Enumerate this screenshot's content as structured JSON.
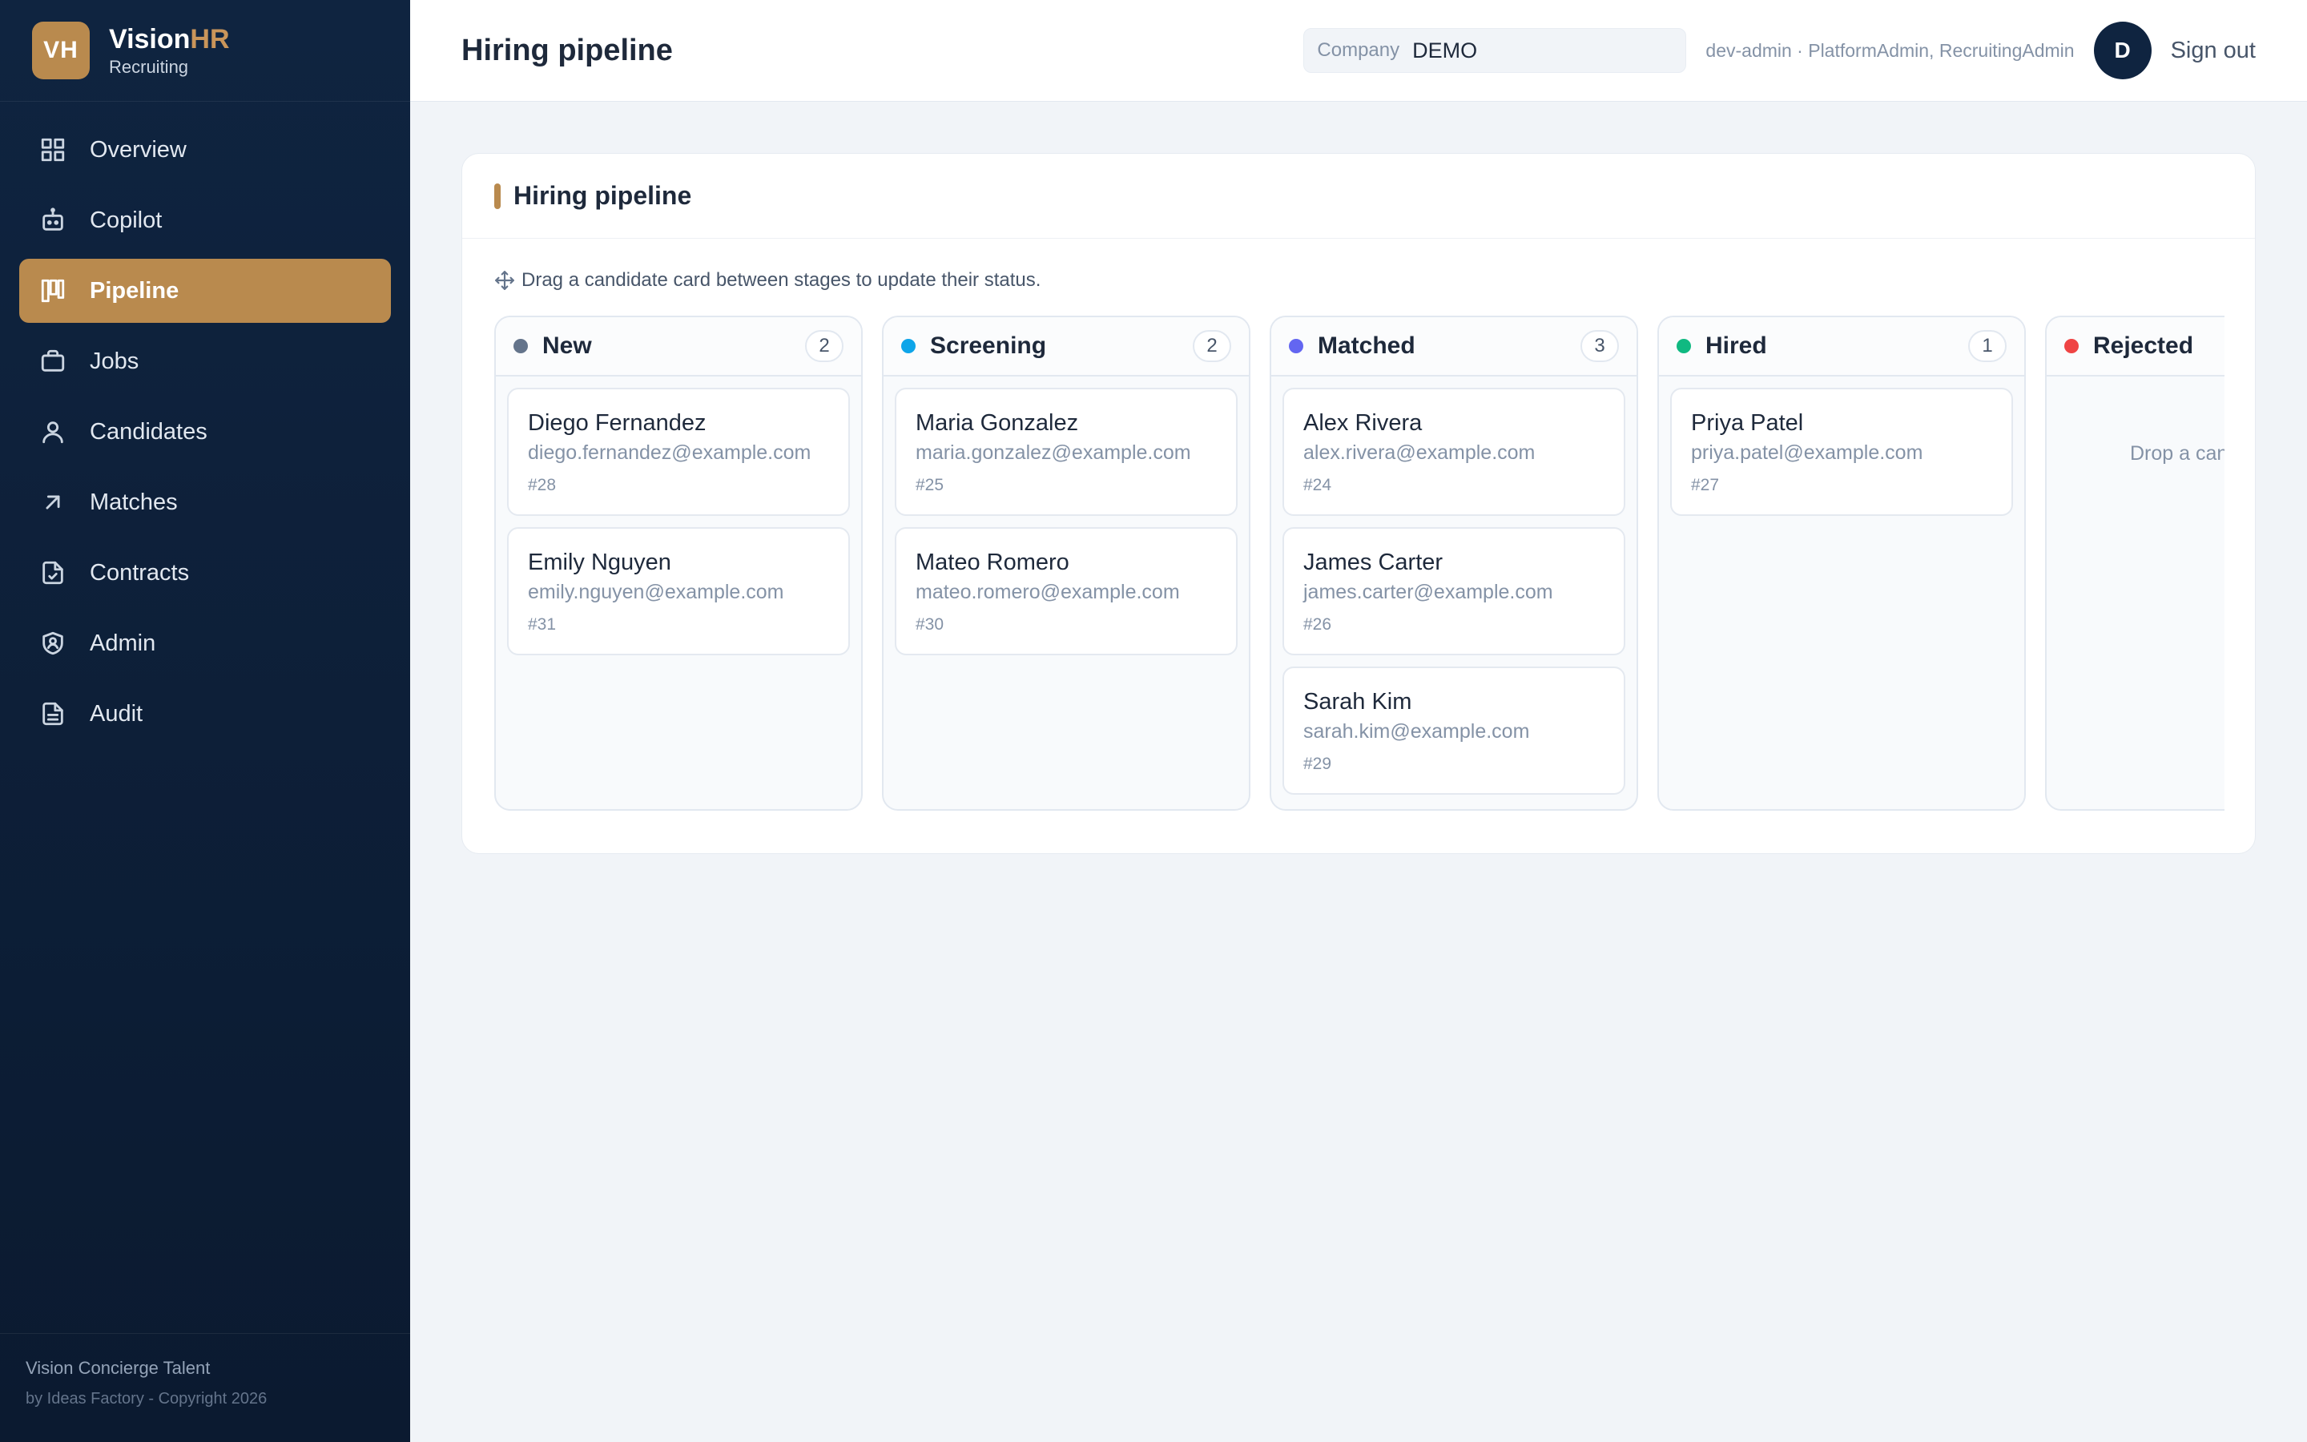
{
  "brand": {
    "logo": "VH",
    "name_main": "Vision",
    "name_accent": "HR",
    "subtitle": "Recruiting"
  },
  "nav": [
    {
      "label": "Overview",
      "icon": "grid-icon"
    },
    {
      "label": "Copilot",
      "icon": "robot-icon"
    },
    {
      "label": "Pipeline",
      "icon": "kanban-icon",
      "active": true
    },
    {
      "label": "Jobs",
      "icon": "briefcase-icon"
    },
    {
      "label": "Candidates",
      "icon": "user-icon"
    },
    {
      "label": "Matches",
      "icon": "arrow-up-right-icon"
    },
    {
      "label": "Contracts",
      "icon": "file-check-icon"
    },
    {
      "label": "Admin",
      "icon": "shield-user-icon"
    },
    {
      "label": "Audit",
      "icon": "file-text-icon"
    }
  ],
  "footer": {
    "line1": "Vision Concierge Talent",
    "line2": "by Ideas Factory - Copyright 2026"
  },
  "header": {
    "title": "Hiring pipeline",
    "company_label": "Company",
    "company_value": "DEMO",
    "user_info": "dev-admin · PlatformAdmin, RecruitingAdmin",
    "avatar": "D",
    "sign_out": "Sign out"
  },
  "panel": {
    "title": "Hiring pipeline",
    "hint": "Drag a candidate card between stages to update their status."
  },
  "colors": {
    "accent": "#b98a4e",
    "sidebar": "#0f2440"
  },
  "columns": [
    {
      "name": "New",
      "count": "2",
      "color": "#64748b",
      "cards": [
        {
          "name": "Diego Fernandez",
          "email": "diego.fernandez@example.com",
          "id": "#28"
        },
        {
          "name": "Emily Nguyen",
          "email": "emily.nguyen@example.com",
          "id": "#31"
        }
      ]
    },
    {
      "name": "Screening",
      "count": "2",
      "color": "#0ea5e9",
      "cards": [
        {
          "name": "Maria Gonzalez",
          "email": "maria.gonzalez@example.com",
          "id": "#25"
        },
        {
          "name": "Mateo Romero",
          "email": "mateo.romero@example.com",
          "id": "#30"
        }
      ]
    },
    {
      "name": "Matched",
      "count": "3",
      "color": "#6366f1",
      "cards": [
        {
          "name": "Alex Rivera",
          "email": "alex.rivera@example.com",
          "id": "#24"
        },
        {
          "name": "James Carter",
          "email": "james.carter@example.com",
          "id": "#26"
        },
        {
          "name": "Sarah Kim",
          "email": "sarah.kim@example.com",
          "id": "#29"
        }
      ]
    },
    {
      "name": "Hired",
      "count": "1",
      "color": "#10b981",
      "cards": [
        {
          "name": "Priya Patel",
          "email": "priya.patel@example.com",
          "id": "#27"
        }
      ]
    },
    {
      "name": "Rejected",
      "count": "",
      "color": "#ef4444",
      "cards": [],
      "drop_hint": "Drop a candidate here"
    }
  ]
}
